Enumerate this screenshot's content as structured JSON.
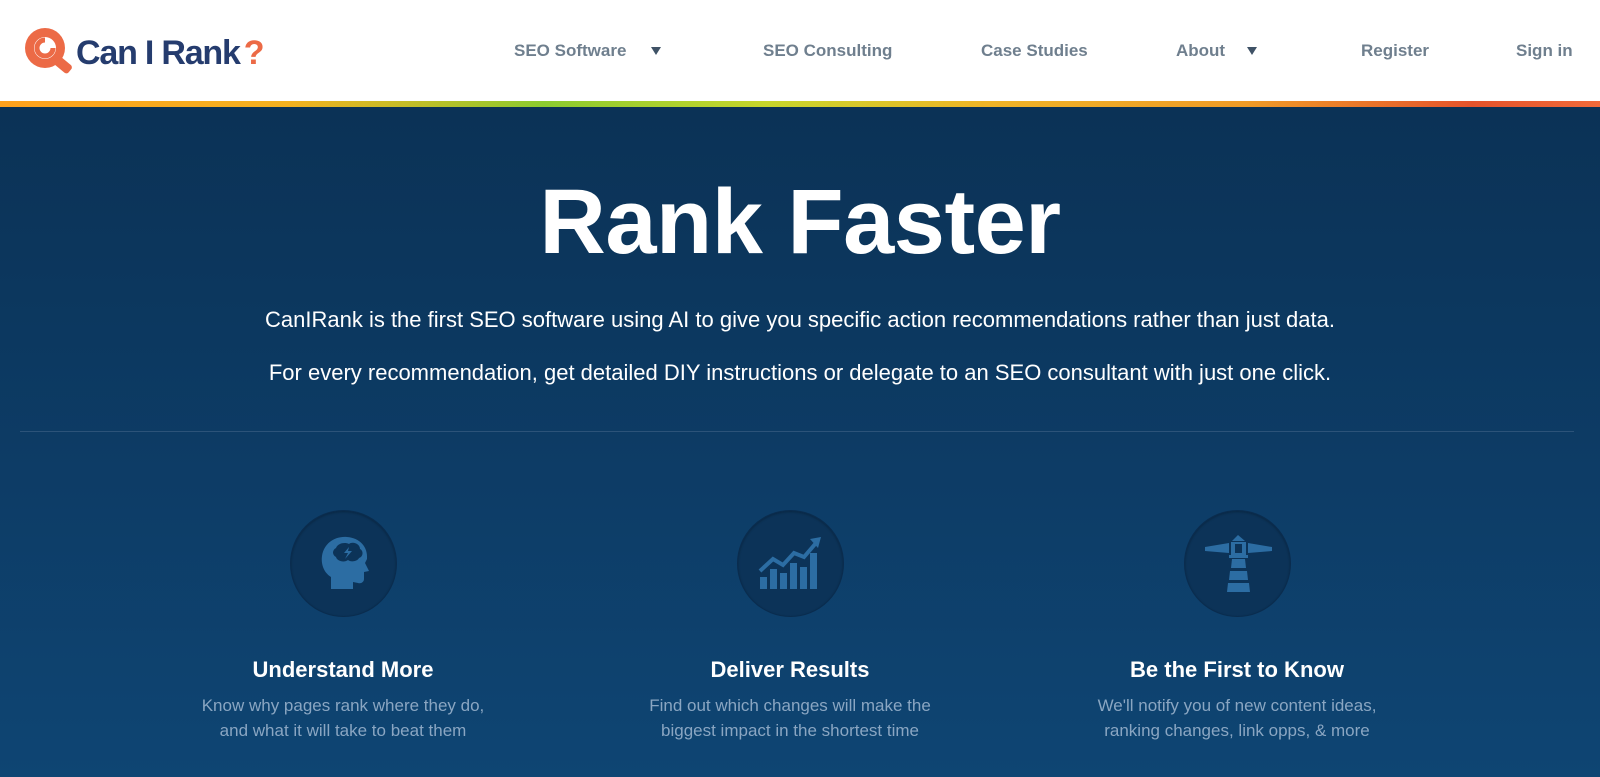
{
  "header": {
    "logo_text": "Can I Rank",
    "logo_question": "?",
    "nav": [
      {
        "label": "SEO Software",
        "has_dropdown": true
      },
      {
        "label": "SEO Consulting",
        "has_dropdown": false
      },
      {
        "label": "Case Studies",
        "has_dropdown": false
      },
      {
        "label": "About",
        "has_dropdown": true
      },
      {
        "label": "Register",
        "has_dropdown": false
      },
      {
        "label": "Sign in",
        "has_dropdown": false
      }
    ]
  },
  "hero": {
    "title": "Rank Faster",
    "line1": "CanIRank is the first SEO software using AI to give you specific action recommendations rather than just data.",
    "line2": "For every recommendation, get detailed DIY instructions or delegate to an SEO consultant with just one click."
  },
  "features": [
    {
      "icon": "brain-head-icon",
      "title": "Understand More",
      "desc_line1": "Know why pages rank where they do,",
      "desc_line2": "and what it will take to beat them"
    },
    {
      "icon": "growth-chart-icon",
      "title": "Deliver Results",
      "desc_line1": "Find out which changes will make the",
      "desc_line2": "biggest impact in the shortest time"
    },
    {
      "icon": "lighthouse-icon",
      "title": "Be the First to Know",
      "desc_line1": "We'll notify you of new content ideas,",
      "desc_line2": "ranking changes, link opps, & more"
    }
  ],
  "colors": {
    "brand_navy": "#253c6e",
    "brand_orange": "#ec6a46",
    "hero_bg": "#0d3a63",
    "icon_blue": "#2c6da3"
  }
}
